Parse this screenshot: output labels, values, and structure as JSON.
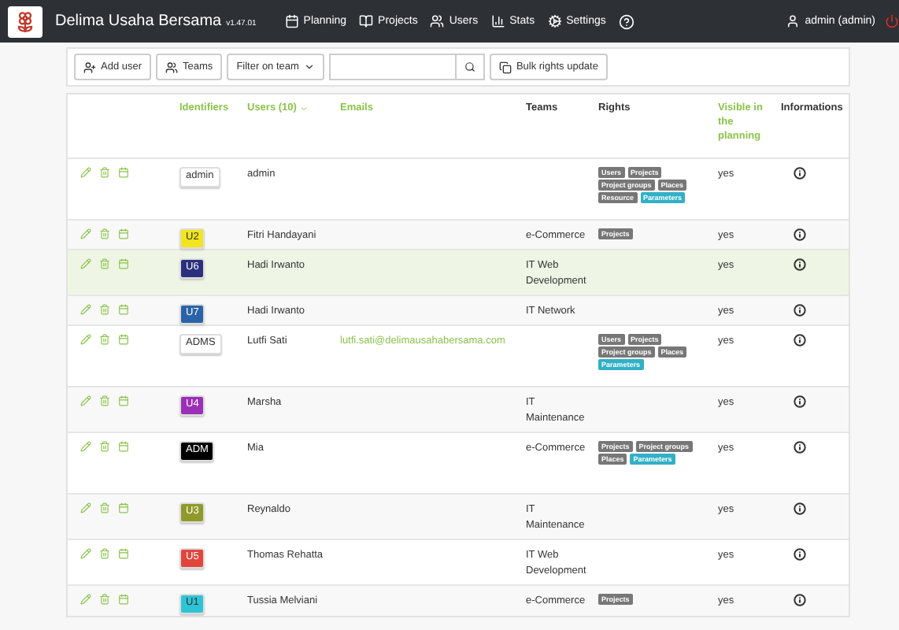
{
  "navbar": {
    "title": "Delima Usaha Bersama",
    "version": "v1.47.01",
    "items": [
      {
        "kind": "planning",
        "label": "Planning"
      },
      {
        "kind": "projects",
        "label": "Projects"
      },
      {
        "kind": "users",
        "label": "Users"
      },
      {
        "kind": "stats",
        "label": "Stats"
      },
      {
        "kind": "settings",
        "label": "Settings"
      },
      {
        "kind": "help"
      }
    ],
    "user": "admin (admin)"
  },
  "toolbar": {
    "add_user": "Add user",
    "teams": "Teams",
    "filter": "Filter on team",
    "bulk": "Bulk rights update"
  },
  "table": {
    "columns": [
      {
        "label": "Identifiers",
        "sortable": true
      },
      {
        "label": "Users (10)",
        "sortable": true,
        "sorted": true
      },
      {
        "label": "Emails",
        "sortable": true
      },
      {
        "label": "Teams",
        "sortable": false
      },
      {
        "label": "Rights",
        "sortable": false
      },
      {
        "label": "Visible in the planning",
        "sortable": true
      },
      {
        "label": "Informations",
        "sortable": false
      }
    ],
    "rows": [
      {
        "id": "admin",
        "color": "#ffffff",
        "user": "admin",
        "rights": [
          {
            "label": "Users",
            "kind": "right"
          },
          {
            "label": "Projects",
            "kind": "right"
          },
          {
            "label": "Project groups",
            "kind": "right"
          },
          {
            "label": "Places",
            "kind": "right"
          },
          {
            "label": "Resource",
            "kind": "right"
          },
          {
            "label": "Parameters",
            "kind": "admin"
          }
        ],
        "visible": "yes",
        "highlighted": false
      },
      {
        "id": "U2",
        "color": "#f2e51d",
        "user": "Fitri Handayani",
        "team": "e-Commerce",
        "rights": [
          {
            "label": "Projects",
            "kind": "right"
          }
        ],
        "visible": "yes",
        "highlighted": false
      },
      {
        "id": "U6",
        "color": "#2b2f7c",
        "user": "Hadi Irwanto",
        "team": "IT Web Development",
        "visible": "yes",
        "highlighted": true
      },
      {
        "id": "U7",
        "color": "#2a63a8",
        "user": "Hadi Irwanto",
        "team": "IT Network",
        "visible": "yes",
        "highlighted": false
      },
      {
        "id": "ADMS",
        "color": "#ffffff",
        "user": "Lutfi Sati",
        "email": "lutfi.sati@delimausahabersama.com",
        "rights": [
          {
            "label": "Users",
            "kind": "right"
          },
          {
            "label": "Projects",
            "kind": "right"
          },
          {
            "label": "Project groups",
            "kind": "right"
          },
          {
            "label": "Places",
            "kind": "right"
          },
          {
            "label": "Parameters",
            "kind": "admin"
          }
        ],
        "visible": "yes",
        "highlighted": false
      },
      {
        "id": "U4",
        "color": "#9b2fb5",
        "user": "Marsha",
        "team": "IT Maintenance",
        "visible": "yes",
        "highlighted": false
      },
      {
        "id": "ADM",
        "color": "#000000",
        "user": "Mia",
        "team": "e-Commerce",
        "rights": [
          {
            "label": "Projects",
            "kind": "right"
          },
          {
            "label": "Project groups",
            "kind": "right"
          },
          {
            "label": "Places",
            "kind": "right"
          },
          {
            "label": "Parameters",
            "kind": "admin"
          }
        ],
        "visible": "yes",
        "highlighted": false
      },
      {
        "id": "U3",
        "color": "#8f9a2a",
        "user": "Reynaldo",
        "team": "IT Maintenance",
        "visible": "yes",
        "highlighted": false
      },
      {
        "id": "U5",
        "color": "#e2453c",
        "user": "Thomas Rehatta",
        "team": "IT Web Development",
        "visible": "yes",
        "highlighted": false
      },
      {
        "id": "U1",
        "color": "#2ec4d6",
        "user": "Tussia Melviani",
        "team": "e-Commerce",
        "rights": [
          {
            "label": "Projects",
            "kind": "right"
          }
        ],
        "visible": "yes",
        "highlighted": false
      }
    ]
  }
}
